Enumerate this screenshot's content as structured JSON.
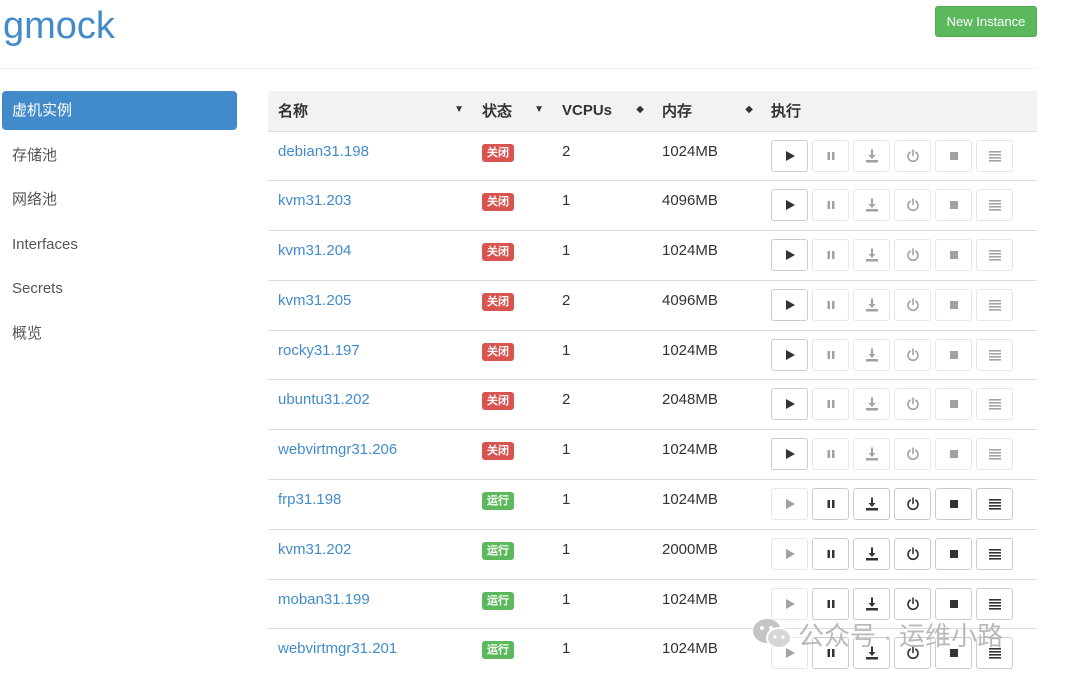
{
  "header": {
    "title": "gmock",
    "new_button": "New Instance"
  },
  "sidebar": {
    "items": [
      {
        "label": "虚机实例",
        "active": true
      },
      {
        "label": "存储池"
      },
      {
        "label": "网络池"
      },
      {
        "label": "Interfaces"
      },
      {
        "label": "Secrets"
      },
      {
        "label": "概览"
      }
    ]
  },
  "table": {
    "headers": {
      "name": "名称",
      "status": "状态",
      "vcpus": "VCPUs",
      "memory": "内存",
      "actions": "执行"
    },
    "rows": [
      {
        "name": "debian31.198",
        "status": "关闭",
        "state": "off",
        "vcpus": "2",
        "memory": "1024MB"
      },
      {
        "name": "kvm31.203",
        "status": "关闭",
        "state": "off",
        "vcpus": "1",
        "memory": "4096MB"
      },
      {
        "name": "kvm31.204",
        "status": "关闭",
        "state": "off",
        "vcpus": "1",
        "memory": "1024MB"
      },
      {
        "name": "kvm31.205",
        "status": "关闭",
        "state": "off",
        "vcpus": "2",
        "memory": "4096MB"
      },
      {
        "name": "rocky31.197",
        "status": "关闭",
        "state": "off",
        "vcpus": "1",
        "memory": "1024MB"
      },
      {
        "name": "ubuntu31.202",
        "status": "关闭",
        "state": "off",
        "vcpus": "2",
        "memory": "2048MB"
      },
      {
        "name": "webvirtmgr31.206",
        "status": "关闭",
        "state": "off",
        "vcpus": "1",
        "memory": "1024MB"
      },
      {
        "name": "frp31.198",
        "status": "运行",
        "state": "on",
        "vcpus": "1",
        "memory": "1024MB"
      },
      {
        "name": "kvm31.202",
        "status": "运行",
        "state": "on",
        "vcpus": "1",
        "memory": "2000MB"
      },
      {
        "name": "moban31.199",
        "status": "运行",
        "state": "on",
        "vcpus": "1",
        "memory": "1024MB"
      },
      {
        "name": "webvirtmgr31.201",
        "status": "运行",
        "state": "on",
        "vcpus": "1",
        "memory": "1024MB"
      }
    ],
    "action_icons": [
      "play-icon",
      "pause-icon",
      "download-icon",
      "power-icon",
      "stop-icon",
      "menu-icon"
    ]
  },
  "watermark": {
    "text": "公众号 · 运维小路"
  },
  "colors": {
    "link": "#428bca",
    "success": "#5cb85c",
    "danger": "#d9534f"
  }
}
